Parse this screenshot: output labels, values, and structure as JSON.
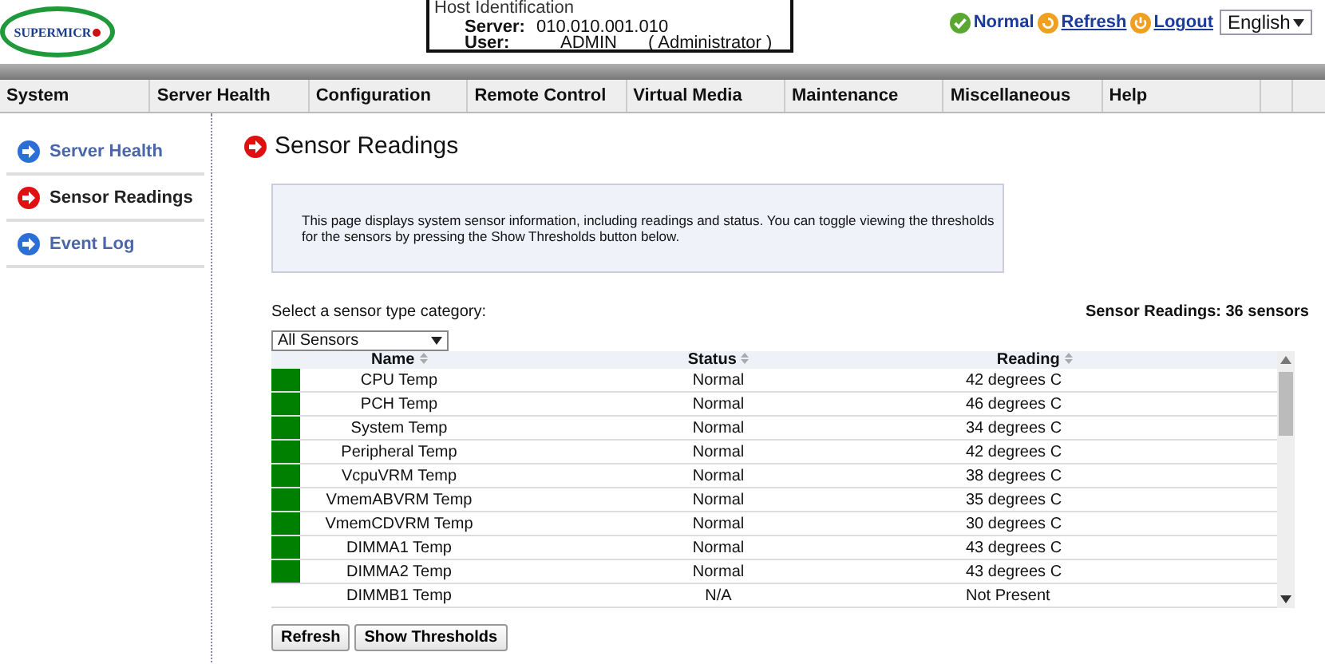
{
  "header": {
    "logo": "SUPERMICR",
    "host_identification": {
      "legend": "Host Identification",
      "server_label": "Server:",
      "server": "010.010.001.010",
      "user_label": "User:",
      "user": "ADMIN",
      "role": "( Administrator )"
    },
    "status": "Normal",
    "refresh": "Refresh",
    "logout": "Logout",
    "language": "English"
  },
  "menu": [
    "System",
    "Server Health",
    "Configuration",
    "Remote Control",
    "Virtual Media",
    "Maintenance",
    "Miscellaneous",
    "Help"
  ],
  "sidebar": {
    "items": [
      {
        "label": "Server Health",
        "selected": false
      },
      {
        "label": "Sensor Readings",
        "selected": true
      },
      {
        "label": "Event Log",
        "selected": false
      }
    ]
  },
  "page": {
    "title": "Sensor Readings",
    "description": "This page displays system sensor information, including readings and status. You can toggle viewing the thresholds for the sensors by pressing the Show Thresholds button below.",
    "category_label": "Select a sensor type category:",
    "category": "All Sensors",
    "count": "Sensor Readings: 36 sensors"
  },
  "table": {
    "columns": [
      "Name",
      "Status",
      "Reading"
    ],
    "rows": [
      {
        "name": "CPU Temp",
        "status": "Normal",
        "reading": "42 degrees C",
        "color": "#008000"
      },
      {
        "name": "PCH Temp",
        "status": "Normal",
        "reading": "46 degrees C",
        "color": "#008000"
      },
      {
        "name": "System Temp",
        "status": "Normal",
        "reading": "34 degrees C",
        "color": "#008000"
      },
      {
        "name": "Peripheral Temp",
        "status": "Normal",
        "reading": "42 degrees C",
        "color": "#008000"
      },
      {
        "name": "VcpuVRM Temp",
        "status": "Normal",
        "reading": "38 degrees C",
        "color": "#008000"
      },
      {
        "name": "VmemABVRM Temp",
        "status": "Normal",
        "reading": "35 degrees C",
        "color": "#008000"
      },
      {
        "name": "VmemCDVRM Temp",
        "status": "Normal",
        "reading": "30 degrees C",
        "color": "#008000"
      },
      {
        "name": "DIMMA1 Temp",
        "status": "Normal",
        "reading": "43 degrees C",
        "color": "#008000"
      },
      {
        "name": "DIMMA2 Temp",
        "status": "Normal",
        "reading": "43 degrees C",
        "color": "#008000"
      },
      {
        "name": "DIMMB1 Temp",
        "status": "N/A",
        "reading": "Not Present"
      }
    ]
  },
  "buttons": [
    "Refresh",
    "Show Thresholds"
  ]
}
